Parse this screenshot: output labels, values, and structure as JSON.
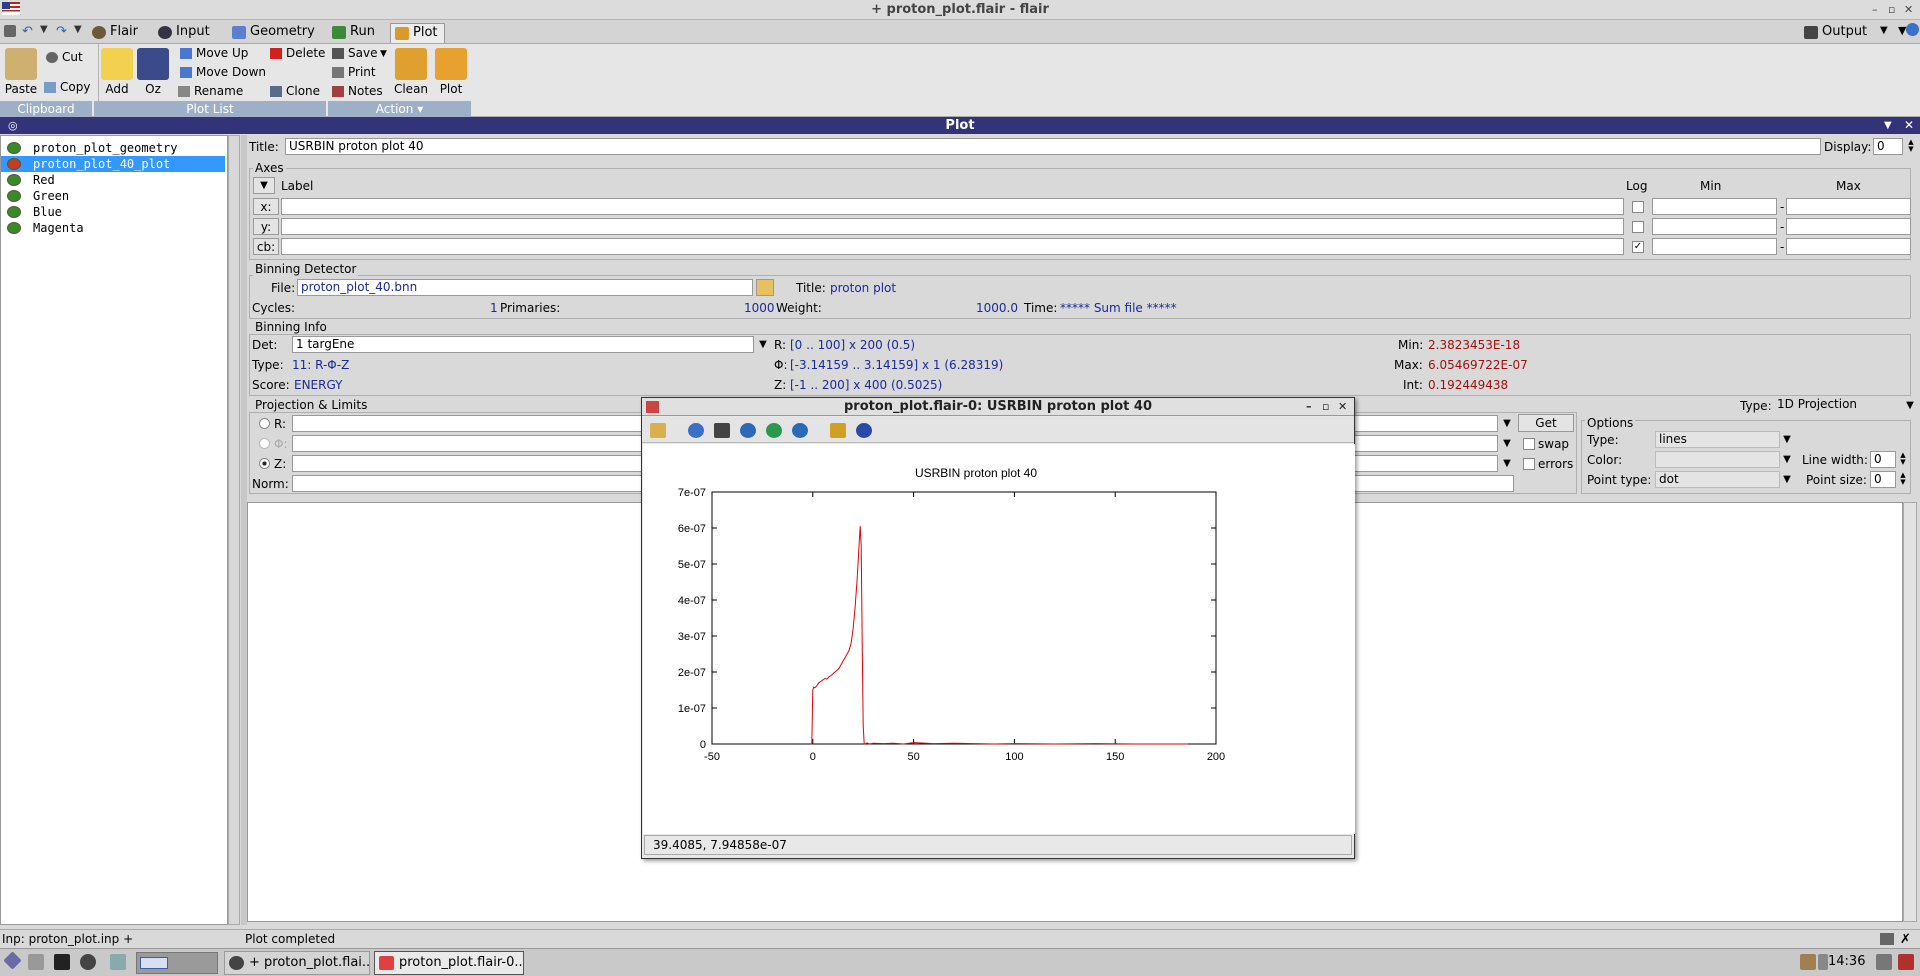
{
  "window": {
    "title": "+ proton_plot.flair - flair"
  },
  "menu": {
    "tabs": [
      {
        "label": "Flair"
      },
      {
        "label": "Input"
      },
      {
        "label": "Geometry"
      },
      {
        "label": "Run"
      },
      {
        "label": "Plot"
      }
    ],
    "output_label": "Output"
  },
  "ribbon": {
    "paste": "Paste",
    "cut": "Cut",
    "copy": "Copy",
    "add": "Add",
    "oz": "Oz",
    "move_up": "Move Up",
    "move_down": "Move Down",
    "rename": "Rename",
    "delete": "Delete",
    "clone": "Clone",
    "save": "Save",
    "print": "Print",
    "notes": "Notes",
    "clean": "Clean",
    "plot": "Plot",
    "groups": {
      "clipboard": "Clipboard",
      "plot_list": "Plot List",
      "action": "Action"
    }
  },
  "plot_header": "Plot",
  "plot_list": [
    {
      "label": "proton_plot_geometry"
    },
    {
      "label": "proton_plot_40_plot"
    },
    {
      "label": "Red"
    },
    {
      "label": "Green"
    },
    {
      "label": "Blue"
    },
    {
      "label": "Magenta"
    }
  ],
  "form": {
    "title_label": "Title:",
    "title_value": "USRBIN proton plot 40",
    "display_label": "Display:",
    "display_value": "0",
    "axes": {
      "group": "Axes",
      "label_header": "Label",
      "log_header": "Log",
      "min_header": "Min",
      "max_header": "Max",
      "x": "x:",
      "y": "y:",
      "cb": "cb:",
      "dash": "-"
    },
    "detector": {
      "group": "Binning Detector",
      "file_label": "File:",
      "file_value": "proton_plot_40.bnn",
      "title_label": "Title:",
      "title_value": "proton plot",
      "cycles_label": "Cycles:",
      "cycles_value": "1",
      "primaries_label": "Primaries:",
      "primaries_value": "1000",
      "weight_label": "Weight:",
      "weight_value": "1000.0",
      "time_label": "Time:",
      "time_value": "***** Sum file *****"
    },
    "info": {
      "group": "Binning Info",
      "det_label": "Det:",
      "det_value": "1 targEne",
      "type_label": "Type:",
      "type_value": "11: R-Φ-Z",
      "score_label": "Score:",
      "score_value": "ENERGY",
      "r_label": "R:",
      "r_value": "[0 .. 100] x 200 (0.5)",
      "phi_label": "Φ:",
      "phi_value": "[-3.14159 .. 3.14159] x 1 (6.28319)",
      "z_label": "Z:",
      "z_value": "[-1 .. 200] x 400 (0.5025)",
      "min_label": "Min:",
      "min_value": "2.3823453E-18",
      "max_label": "Max:",
      "max_value": "6.05469722E-07",
      "int_label": "Int:",
      "int_value": "0.192449438"
    },
    "projection": {
      "group": "Projection & Limits",
      "r_label": "R:",
      "phi_label": "Φ:",
      "z_label": "Z:",
      "norm_label": "Norm:",
      "get_button": "Get",
      "swap": "swap",
      "errors": "errors",
      "type_label": "Type:",
      "type_value": "1D Projection"
    },
    "options": {
      "group": "Options",
      "type_label": "Type:",
      "type_value": "lines",
      "color_label": "Color:",
      "color_value": "",
      "point_type_label": "Point type:",
      "point_type_value": "dot",
      "line_width_label": "Line width:",
      "line_width_value": "0",
      "point_size_label": "Point size:",
      "point_size_value": "0"
    }
  },
  "status": {
    "left": "Inp: proton_plot.inp +",
    "right": "Plot completed"
  },
  "taskbar": {
    "items": [
      {
        "label": "+ proton_plot.flai..."
      },
      {
        "label": "proton_plot.flair-0..."
      }
    ],
    "clock": "14:36"
  },
  "popup": {
    "title": "proton_plot.flair-0: USRBIN proton plot 40",
    "status": "39.4085,  7.94858e-07",
    "line_color": "#e00000"
  },
  "chart_data": {
    "type": "line",
    "title": "USRBIN proton plot 40",
    "xlabel": "",
    "ylabel": "",
    "xlim": [
      -50,
      200
    ],
    "ylim": [
      0,
      7e-07
    ],
    "x_ticks": [
      "-50",
      "0",
      "50",
      "100",
      "150",
      "200"
    ],
    "y_ticks": [
      "0",
      "1e-07",
      "2e-07",
      "3e-07",
      "4e-07",
      "5e-07",
      "6e-07",
      "7e-07"
    ],
    "grid": false,
    "series": [
      {
        "x": [
          -1,
          -0.5,
          0,
          0.5,
          1,
          2,
          3,
          4,
          5,
          6,
          7,
          8,
          9,
          10,
          11,
          12,
          13,
          14,
          15,
          16,
          17,
          18,
          19,
          20,
          21,
          22,
          23,
          23.5,
          24,
          24.5,
          25,
          25.5,
          26,
          27,
          28,
          30,
          35,
          40,
          45,
          50,
          60,
          70,
          80,
          90,
          100,
          120,
          140,
          160,
          180,
          186
        ],
        "y": [
          0,
          0,
          1.5e-07,
          1.58e-07,
          1.56e-07,
          1.62e-07,
          1.7e-07,
          1.74e-07,
          1.78e-07,
          1.82e-07,
          1.8e-07,
          1.86e-07,
          1.9e-07,
          1.95e-07,
          2e-07,
          2.05e-07,
          2.1e-07,
          2.2e-07,
          2.3e-07,
          2.4e-07,
          2.5e-07,
          2.6e-07,
          2.8e-07,
          3.2e-07,
          3.8e-07,
          4.6e-07,
          5.6e-07,
          6.05e-07,
          5.5e-07,
          2.8e-07,
          5e-08,
          1e-09,
          0,
          3e-09,
          0,
          2e-09,
          1e-09,
          2e-09,
          0,
          4e-09,
          1e-09,
          2e-09,
          1e-09,
          0,
          1e-09,
          0,
          1e-09,
          0,
          0,
          0
        ]
      }
    ]
  }
}
